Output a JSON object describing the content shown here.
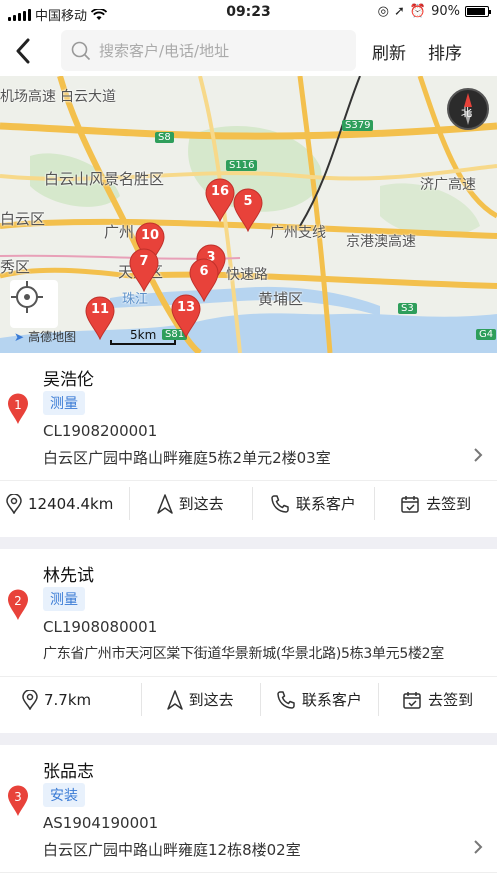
{
  "status": {
    "carrier": "中国移动",
    "time": "09:23",
    "battery": "90%",
    "battery_level": 0.9
  },
  "nav": {
    "search_placeholder": "搜索客户/电话/地址",
    "refresh": "刷新",
    "sort": "排序"
  },
  "map": {
    "labels": [
      "白云山风景名胜区",
      "白云区",
      "广州",
      "天河区",
      "秀区",
      "珠江",
      "黄埔区",
      "京港澳高速",
      "快速路",
      "广州支线",
      "济广高速",
      "机场高速",
      "白云大道"
    ],
    "roads": [
      "S8",
      "S116",
      "S379",
      "S3",
      "S81",
      "G4"
    ],
    "pins": [
      "16",
      "5",
      "10",
      "7",
      "3",
      "6",
      "11",
      "13"
    ],
    "compass_label": "北",
    "scale": "5km",
    "brand": "高德地图"
  },
  "customers": [
    {
      "index": "1",
      "name": "吴浩伦",
      "tag": "测量",
      "code": "CL1908200001",
      "address": "白云区广园中路山畔雍庭5栋2单元2楼03室",
      "distance": "12404.4km",
      "go": "到这去",
      "contact": "联系客户",
      "checkin": "去签到"
    },
    {
      "index": "2",
      "name": "林先试",
      "tag": "测量",
      "code": "CL1908080001",
      "address": "广东省广州市天河区棠下街道华景新城(华景北路)5栋3单元5楼2室",
      "distance": "7.7km",
      "go": "到这去",
      "contact": "联系客户",
      "checkin": "去签到"
    },
    {
      "index": "3",
      "name": "张品志",
      "tag": "安装",
      "code": "AS1904190001",
      "address": "白云区广园中路山畔雍庭12栋8楼02室"
    }
  ]
}
